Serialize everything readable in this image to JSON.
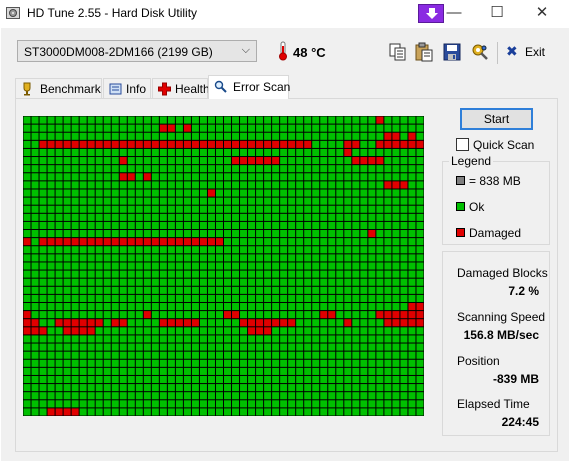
{
  "window": {
    "title": "HD Tune 2.55 - Hard Disk Utility",
    "minimize_glyph": "—",
    "maximize_glyph": "☐",
    "close_glyph": "✕"
  },
  "toolbar": {
    "drive": "ST3000DM008-2DM166 (2199 GB)",
    "temperature": "48 °C",
    "exit_label": "Exit",
    "exit_glyph": "✖"
  },
  "tabs": [
    {
      "label": "Benchmark",
      "icon": "benchmark-icon",
      "active": false
    },
    {
      "label": "Info",
      "icon": "info-icon",
      "active": false
    },
    {
      "label": "Health",
      "icon": "health-icon",
      "active": false
    },
    {
      "label": "Error Scan",
      "icon": "magnifier-icon",
      "active": true
    }
  ],
  "scan": {
    "start_label": "Start",
    "quick_scan_label": "Quick Scan",
    "quick_scan_checked": false
  },
  "legend": {
    "title": "Legend",
    "items": [
      {
        "label": "= 838 MB",
        "color": "#7f7f7f"
      },
      {
        "label": "Ok",
        "color": "#00c000"
      },
      {
        "label": "Damaged",
        "color": "#e00000"
      }
    ]
  },
  "stats": {
    "damaged_blocks_label": "Damaged Blocks",
    "damaged_blocks_value": "7.2 %",
    "scanning_speed_label": "Scanning Speed",
    "scanning_speed_value": "156.8 MB/sec",
    "position_label": "Position",
    "position_value": "-839 MB",
    "elapsed_time_label": "Elapsed Time",
    "elapsed_time_value": "224:45"
  },
  "error_map": {
    "columns": 50,
    "rows": 37,
    "ok_color": "#00c000",
    "damaged_color": "#e00000",
    "damaged_cells": [
      [
        0,
        44
      ],
      [
        1,
        17
      ],
      [
        1,
        18
      ],
      [
        1,
        20
      ],
      [
        2,
        45
      ],
      [
        2,
        46
      ],
      [
        2,
        48
      ],
      [
        3,
        2
      ],
      [
        3,
        3
      ],
      [
        3,
        4
      ],
      [
        3,
        5
      ],
      [
        3,
        6
      ],
      [
        3,
        7
      ],
      [
        3,
        8
      ],
      [
        3,
        9
      ],
      [
        3,
        10
      ],
      [
        3,
        11
      ],
      [
        3,
        12
      ],
      [
        3,
        13
      ],
      [
        3,
        14
      ],
      [
        3,
        15
      ],
      [
        3,
        16
      ],
      [
        3,
        17
      ],
      [
        3,
        18
      ],
      [
        3,
        19
      ],
      [
        3,
        20
      ],
      [
        3,
        21
      ],
      [
        3,
        22
      ],
      [
        3,
        23
      ],
      [
        3,
        24
      ],
      [
        3,
        25
      ],
      [
        3,
        26
      ],
      [
        3,
        27
      ],
      [
        3,
        28
      ],
      [
        3,
        29
      ],
      [
        3,
        30
      ],
      [
        3,
        31
      ],
      [
        3,
        32
      ],
      [
        3,
        33
      ],
      [
        3,
        34
      ],
      [
        3,
        35
      ],
      [
        3,
        40
      ],
      [
        3,
        41
      ],
      [
        3,
        44
      ],
      [
        3,
        45
      ],
      [
        3,
        46
      ],
      [
        3,
        47
      ],
      [
        3,
        48
      ],
      [
        3,
        49
      ],
      [
        4,
        40
      ],
      [
        5,
        12
      ],
      [
        5,
        26
      ],
      [
        5,
        27
      ],
      [
        5,
        28
      ],
      [
        5,
        29
      ],
      [
        5,
        30
      ],
      [
        5,
        31
      ],
      [
        5,
        41
      ],
      [
        5,
        42
      ],
      [
        5,
        43
      ],
      [
        5,
        44
      ],
      [
        7,
        12
      ],
      [
        7,
        13
      ],
      [
        7,
        15
      ],
      [
        8,
        45
      ],
      [
        8,
        46
      ],
      [
        8,
        47
      ],
      [
        9,
        23
      ],
      [
        14,
        43
      ],
      [
        15,
        0
      ],
      [
        15,
        2
      ],
      [
        15,
        3
      ],
      [
        15,
        4
      ],
      [
        15,
        5
      ],
      [
        15,
        6
      ],
      [
        15,
        7
      ],
      [
        15,
        8
      ],
      [
        15,
        9
      ],
      [
        15,
        10
      ],
      [
        15,
        11
      ],
      [
        15,
        12
      ],
      [
        15,
        13
      ],
      [
        15,
        14
      ],
      [
        15,
        15
      ],
      [
        15,
        16
      ],
      [
        15,
        17
      ],
      [
        15,
        18
      ],
      [
        15,
        19
      ],
      [
        15,
        20
      ],
      [
        15,
        21
      ],
      [
        15,
        22
      ],
      [
        15,
        23
      ],
      [
        15,
        24
      ],
      [
        23,
        48
      ],
      [
        23,
        49
      ],
      [
        24,
        0
      ],
      [
        24,
        15
      ],
      [
        24,
        25
      ],
      [
        24,
        26
      ],
      [
        24,
        37
      ],
      [
        24,
        38
      ],
      [
        24,
        44
      ],
      [
        24,
        45
      ],
      [
        24,
        46
      ],
      [
        24,
        47
      ],
      [
        24,
        48
      ],
      [
        24,
        49
      ],
      [
        25,
        0
      ],
      [
        25,
        1
      ],
      [
        25,
        4
      ],
      [
        25,
        5
      ],
      [
        25,
        6
      ],
      [
        25,
        7
      ],
      [
        25,
        8
      ],
      [
        25,
        9
      ],
      [
        25,
        11
      ],
      [
        25,
        12
      ],
      [
        25,
        17
      ],
      [
        25,
        18
      ],
      [
        25,
        19
      ],
      [
        25,
        20
      ],
      [
        25,
        21
      ],
      [
        25,
        27
      ],
      [
        25,
        28
      ],
      [
        25,
        29
      ],
      [
        25,
        30
      ],
      [
        25,
        31
      ],
      [
        25,
        32
      ],
      [
        25,
        33
      ],
      [
        25,
        40
      ],
      [
        25,
        45
      ],
      [
        25,
        46
      ],
      [
        25,
        47
      ],
      [
        25,
        48
      ],
      [
        25,
        49
      ],
      [
        26,
        0
      ],
      [
        26,
        1
      ],
      [
        26,
        2
      ],
      [
        26,
        5
      ],
      [
        26,
        6
      ],
      [
        26,
        7
      ],
      [
        26,
        8
      ],
      [
        26,
        28
      ],
      [
        26,
        29
      ],
      [
        26,
        30
      ],
      [
        36,
        3
      ],
      [
        36,
        4
      ],
      [
        36,
        5
      ],
      [
        36,
        6
      ]
    ]
  }
}
